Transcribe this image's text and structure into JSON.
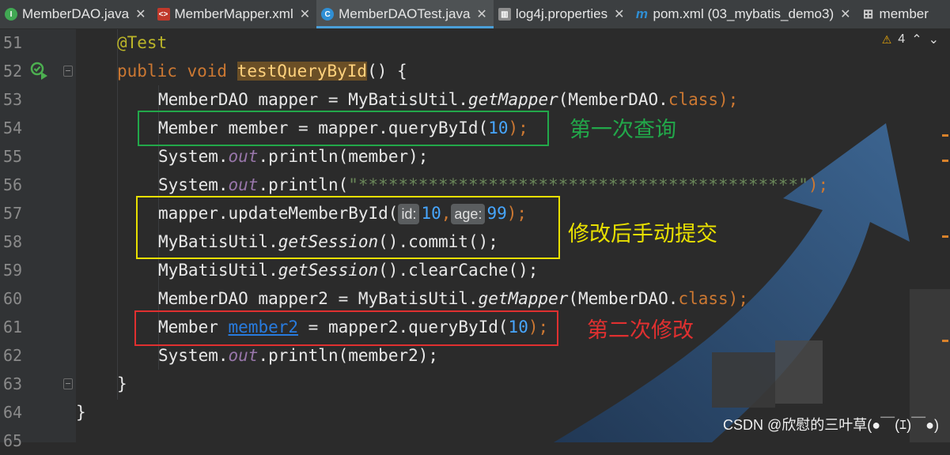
{
  "tabs": [
    {
      "label": "MemberDAO.java",
      "icon": "interface-icon",
      "active": false
    },
    {
      "label": "MemberMapper.xml",
      "icon": "xml-file-icon",
      "active": false
    },
    {
      "label": "MemberDAOTest.java",
      "icon": "class-icon",
      "active": true
    },
    {
      "label": "log4j.properties",
      "icon": "properties-file-icon",
      "active": false
    },
    {
      "label": "pom.xml (03_mybatis_demo3)",
      "icon": "maven-icon",
      "active": false
    },
    {
      "label": "member",
      "icon": "table-icon",
      "active": false
    }
  ],
  "editor": {
    "line_numbers": [
      "51",
      "52",
      "53",
      "54",
      "55",
      "56",
      "57",
      "58",
      "59",
      "60",
      "61",
      "62",
      "63",
      "64",
      "65"
    ],
    "warnings_count": "4",
    "code": {
      "l51": "@Test",
      "l52_mod": "public void ",
      "l52_name": "testQueryById",
      "l52_end": "() {",
      "l53": {
        "a": "MemberDAO mapper = MyBatisUtil.",
        "b": "getMapper",
        "c": "(MemberDAO.",
        "d": "class",
        "e": ");"
      },
      "l54": {
        "a": "Member member = mapper.queryById(",
        "n": "10",
        "e": ");"
      },
      "l55": {
        "a": "System.",
        "f": "out",
        "b": ".println(member);"
      },
      "l56": {
        "a": "System.",
        "f": "out",
        "b": ".println(",
        "s": "\"********************************************\"",
        "e": ");"
      },
      "l57": {
        "a": "mapper.updateMemberById(",
        "h1": "id:",
        "n1": "10",
        "c": ",",
        "h2": "age:",
        "n2": "99",
        "e": ");"
      },
      "l58": {
        "a": "MyBatisUtil.",
        "b": "getSession",
        "c": "().commit();"
      },
      "l59": {
        "a": "MyBatisUtil.",
        "b": "getSession",
        "c": "().clearCache();"
      },
      "l60": {
        "a": "MemberDAO mapper2 = MyBatisUtil.",
        "b": "getMapper",
        "c": "(MemberDAO.",
        "d": "class",
        "e": ");"
      },
      "l61": {
        "a": "Member ",
        "link": "member2",
        "b": " = mapper2.queryById(",
        "n": "10",
        "e": ");"
      },
      "l62": {
        "a": "System.",
        "f": "out",
        "b": ".println(member2);"
      },
      "l63": "}",
      "l64": "}"
    }
  },
  "annotations": {
    "first_query": "第一次查询",
    "modify_commit": "修改后手动提交",
    "second_modify": "第二次修改"
  },
  "colors": {
    "green_box": "#22a84a",
    "yellow_box": "#e8e000",
    "red_box": "#e03030"
  },
  "watermark": "CSDN @欣慰的三叶草(●￣(ｴ)￣●)"
}
